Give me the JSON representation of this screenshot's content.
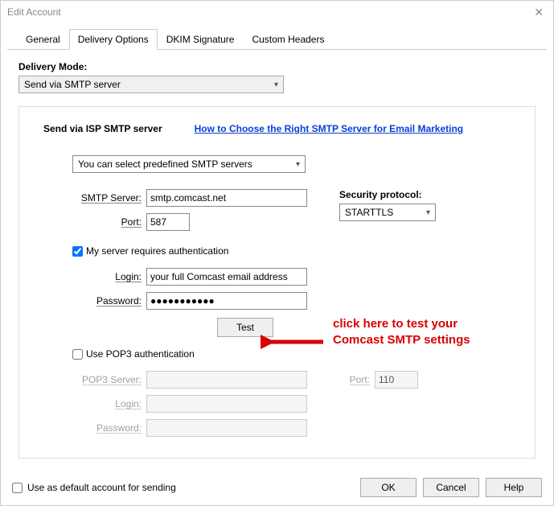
{
  "window": {
    "title": "Edit Account"
  },
  "tabs": {
    "general": "General",
    "delivery": "Delivery Options",
    "dkim": "DKIM Signature",
    "custom": "Custom Headers"
  },
  "deliveryMode": {
    "label": "Delivery Mode:",
    "value": "Send via SMTP server"
  },
  "section": {
    "title": "Send via ISP SMTP server",
    "helpLink": "How to Choose the Right SMTP Server for Email Marketing",
    "predefSelect": "You can select predefined SMTP servers",
    "smtpServerLabel": "SMTP Server:",
    "smtpServerValue": "smtp.comcast.net",
    "portLabel": "Port:",
    "portValue": "587",
    "securityLabel": "Security protocol:",
    "securityValue": "STARTTLS",
    "authCheckbox": "My server requires authentication",
    "loginLabel": "Login:",
    "loginValue": "your full Comcast email address",
    "passwordLabel": "Password:",
    "passwordValue": "●●●●●●●●●●●",
    "testButton": "Test",
    "pop3Checkbox": "Use POP3 authentication",
    "pop3ServerLabel": "POP3 Server:",
    "pop3ServerValue": "",
    "pop3PortLabel": "Port:",
    "pop3PortValue": "110",
    "pop3LoginLabel": "Login:",
    "pop3LoginValue": "",
    "pop3PasswordLabel": "Password:",
    "pop3PasswordValue": ""
  },
  "callout": "click here to test your Comcast SMTP settings",
  "bottom": {
    "defaultCheckbox": "Use as default account for sending",
    "ok": "OK",
    "cancel": "Cancel",
    "help": "Help"
  }
}
